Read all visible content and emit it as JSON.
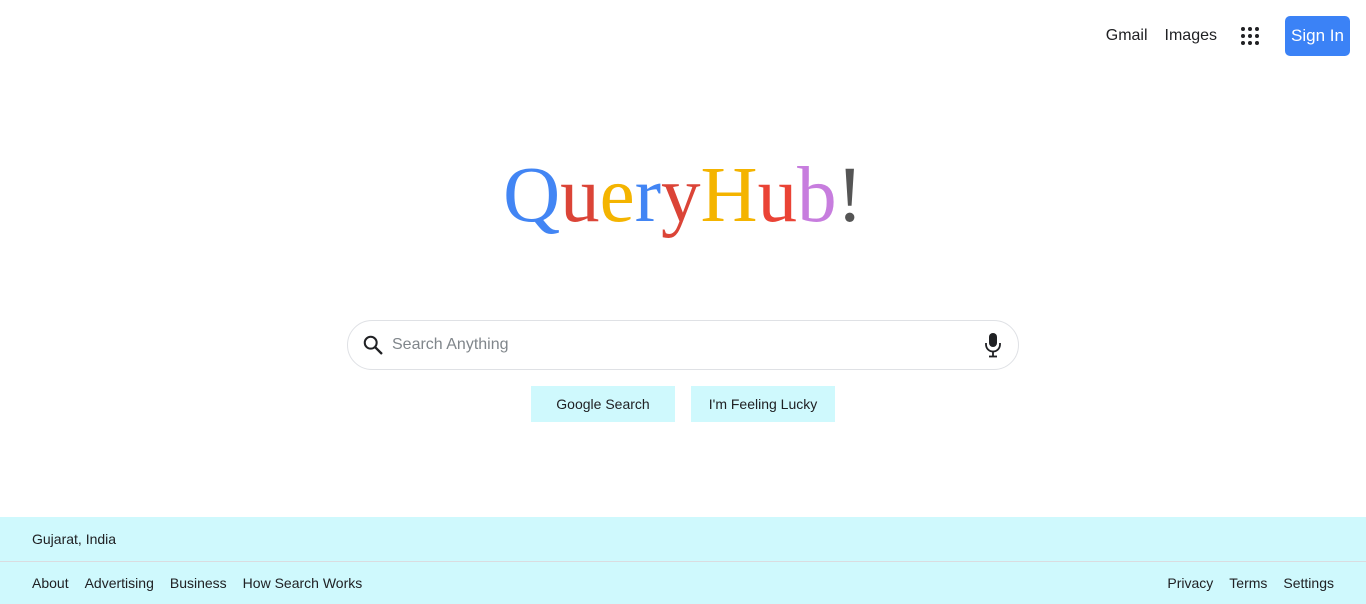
{
  "header": {
    "gmail_label": "Gmail",
    "images_label": "Images",
    "apps_icon": "apps-grid-icon",
    "signin_label": "Sign In",
    "signin_color": "#3b82f6"
  },
  "logo": {
    "letters": [
      {
        "char": "Q",
        "color": "#4285f4"
      },
      {
        "char": "u",
        "color": "#db4437"
      },
      {
        "char": "e",
        "color": "#f4b400"
      },
      {
        "char": "r",
        "color": "#4285f4"
      },
      {
        "char": "y",
        "color": "#db4437"
      },
      {
        "char": "H",
        "color": "#f4b400"
      },
      {
        "char": "u",
        "color": "#ea4335"
      },
      {
        "char": "b",
        "color": "#c77dde"
      },
      {
        "char": "!",
        "color": "#555555"
      }
    ]
  },
  "search": {
    "placeholder": "Search Anything",
    "value": "",
    "search_icon": "search-icon",
    "mic_icon": "microphone-icon"
  },
  "buttons": {
    "google_search": "Google Search",
    "feeling_lucky": "I'm Feeling Lucky",
    "button_color": "#cff9fd"
  },
  "footer": {
    "location": "Gujarat, India",
    "left_links": [
      "About",
      "Advertising",
      "Business",
      "How Search Works"
    ],
    "right_links": [
      "Privacy",
      "Terms",
      "Settings"
    ],
    "background": "#cff9fd"
  }
}
